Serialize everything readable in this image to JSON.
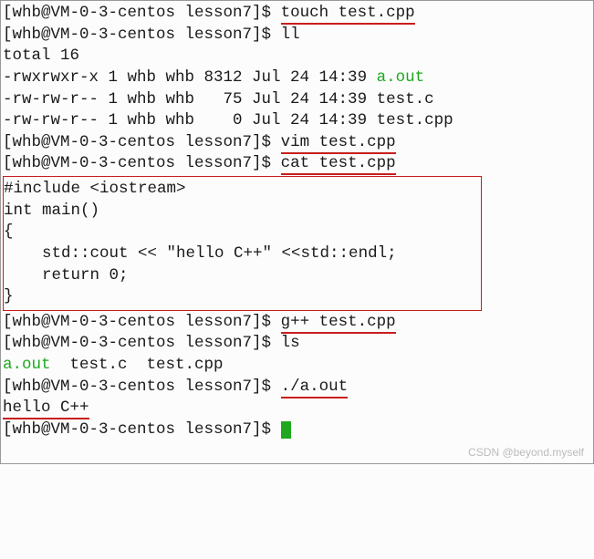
{
  "prompts": {
    "p1": "[whb@VM-0-3-centos lesson7]$ ",
    "p2": "[whb@VM-0-3-centos lesson7]$ "
  },
  "cmds": {
    "touch": "touch test.cpp",
    "ll": "ll",
    "vim": "vim test.cpp",
    "cat": "cat test.cpp",
    "gpp": "g++ test.cpp",
    "ls": "ls",
    "run": "./a.out"
  },
  "ll_output": {
    "total": "total 16",
    "row1_left": "-rwxrwxr-x 1 whb whb 8312 Jul 24 14:39 ",
    "row1_file": "a.out",
    "row2": "-rw-rw-r-- 1 whb whb   75 Jul 24 14:39 test.c",
    "row3": "-rw-rw-r-- 1 whb whb    0 Jul 24 14:39 test.cpp"
  },
  "code": {
    "l1": "#include <iostream>",
    "l2": "",
    "l3": "int main()",
    "l4": "{",
    "l5": "    std::cout << \"hello C++\" <<std::endl;",
    "l6": "    return 0;",
    "l7": "}"
  },
  "ls_output": {
    "f1": "a.out",
    "rest": "  test.c  test.cpp"
  },
  "run_output": "hello C++",
  "watermark": "CSDN @beyond.myself"
}
